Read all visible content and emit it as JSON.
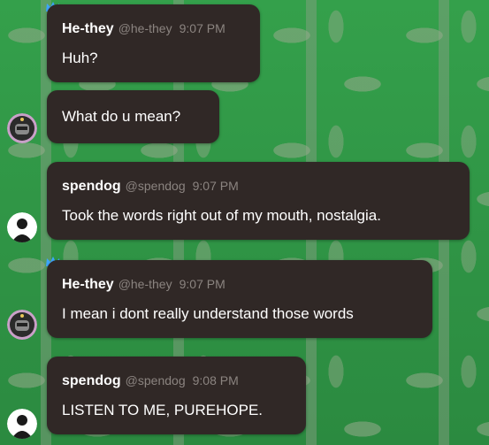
{
  "messages": [
    {
      "name": "He-they",
      "handle": "@he-they",
      "time": "9:07 PM",
      "text": "Huh?"
    },
    {
      "text": "What do u mean?"
    },
    {
      "name": "spendog",
      "handle": "@spendog",
      "time": "9:07 PM",
      "text": "Took the words right out of my mouth, nostalgia."
    },
    {
      "name": "He-they",
      "handle": "@he-they",
      "time": "9:07 PM",
      "text": "I mean i dont really understand those words"
    },
    {
      "name": "spendog",
      "handle": "@spendog",
      "time": "9:08 PM",
      "text": "LISTEN TO ME, PUREHOPE."
    }
  ],
  "colors": {
    "bubble": "#302826",
    "crown": "#3ea6ff",
    "name": "#ffffff",
    "meta": "#8b8480"
  }
}
